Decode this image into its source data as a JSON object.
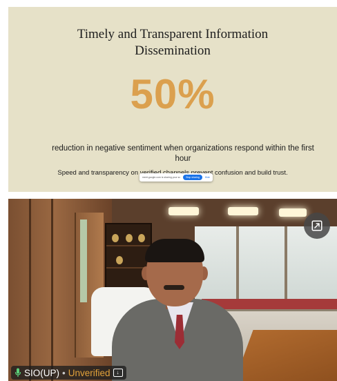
{
  "slide": {
    "title": "Timely and Transparent Information Dissemination",
    "stat": "50%",
    "description": "reduction in negative sentiment when organizations respond within the first hour",
    "subdescription": "Speed and transparency on verified channels prevent confusion and build trust.",
    "share_bar": {
      "text": "meet.google.com is sharing your screen",
      "stop_label": "Stop sharing",
      "hide_label": "Hide"
    }
  },
  "participant": {
    "name": "SIO(UP)",
    "separator": "•",
    "status": "Unverified",
    "status_color": "#e3a23a",
    "icons": [
      "microphone-icon",
      "info-icon"
    ]
  },
  "controls": {
    "expand_icon": "expand-icon"
  },
  "colors": {
    "slide_background": "#e6e1c8",
    "stat_color": "#dba04e"
  }
}
